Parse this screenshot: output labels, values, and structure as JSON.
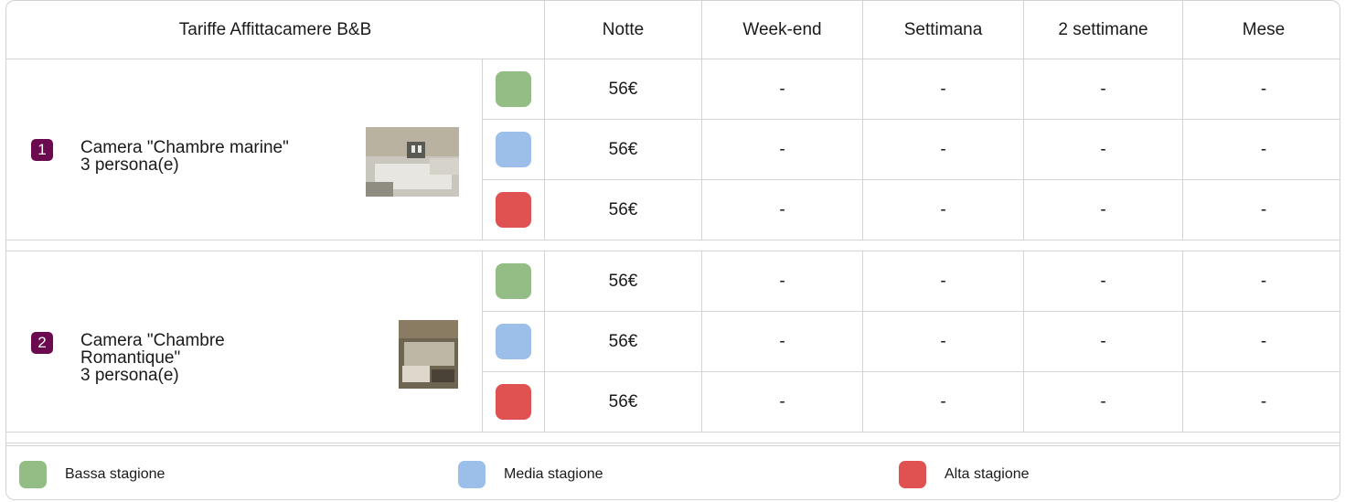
{
  "header": {
    "title": "Tariffe Affittacamere B&B",
    "columns": [
      "Notte",
      "Week-end",
      "Settimana",
      "2 settimane",
      "Mese"
    ]
  },
  "colors": {
    "bassa": "#93bd84",
    "media": "#9bbfe9",
    "alta": "#e05252",
    "badge": "#6b0a4f"
  },
  "rooms": [
    {
      "number": "1",
      "name": "Camera \"Chambre marine\"",
      "capacity": "3 persona(e)",
      "rates": [
        {
          "season": "bassa",
          "cells": [
            "56€",
            "-",
            "-",
            "-",
            "-"
          ]
        },
        {
          "season": "media",
          "cells": [
            "56€",
            "-",
            "-",
            "-",
            "-"
          ]
        },
        {
          "season": "alta",
          "cells": [
            "56€",
            "-",
            "-",
            "-",
            "-"
          ]
        }
      ]
    },
    {
      "number": "2",
      "name": "Camera \"Chambre Romantique\"",
      "capacity": "3 persona(e)",
      "rates": [
        {
          "season": "bassa",
          "cells": [
            "56€",
            "-",
            "-",
            "-",
            "-"
          ]
        },
        {
          "season": "media",
          "cells": [
            "56€",
            "-",
            "-",
            "-",
            "-"
          ]
        },
        {
          "season": "alta",
          "cells": [
            "56€",
            "-",
            "-",
            "-",
            "-"
          ]
        }
      ]
    }
  ],
  "legend": {
    "bassa": "Bassa stagione",
    "media": "Media stagione",
    "alta": "Alta stagione"
  }
}
